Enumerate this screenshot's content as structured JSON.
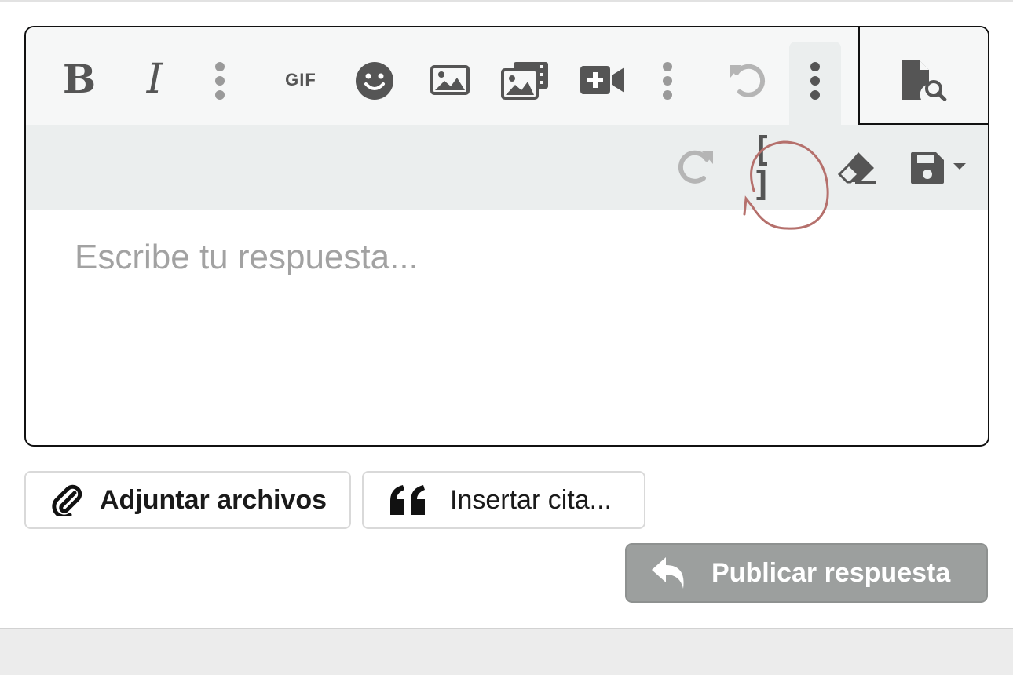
{
  "toolbar": {
    "bold": {
      "label": "B",
      "icon": "bold-icon"
    },
    "italic": {
      "label": "I",
      "icon": "italic-icon"
    },
    "more_text": {
      "icon": "vertical-ellipsis-icon"
    },
    "gif": {
      "label": "GIF",
      "icon": "gif-icon"
    },
    "emoji": {
      "icon": "smiley-icon"
    },
    "image": {
      "icon": "image-icon"
    },
    "media": {
      "icon": "media-gallery-icon"
    },
    "video": {
      "icon": "video-plus-icon"
    },
    "more_insert": {
      "icon": "vertical-ellipsis-icon"
    },
    "undo": {
      "icon": "undo-icon"
    },
    "more_active": {
      "icon": "vertical-ellipsis-icon",
      "active": true
    },
    "preview": {
      "icon": "file-preview-icon"
    },
    "redo": {
      "icon": "redo-icon"
    },
    "bbcode": {
      "label": "[ ]",
      "icon": "brackets-icon"
    },
    "remove_format": {
      "icon": "eraser-icon"
    },
    "drafts": {
      "icon": "save-dropdown-icon"
    }
  },
  "editor": {
    "placeholder": "Escribe tu respuesta..."
  },
  "actions": {
    "attach_label": "Adjuntar archivos",
    "quote_label": "Insertar cita...",
    "publish_label": "Publicar respuesta"
  },
  "colors": {
    "icon": "#555555",
    "icon_muted": "#9a9a9a",
    "annotation": "#b5706c",
    "publish_bg": "#9c9f9e"
  }
}
